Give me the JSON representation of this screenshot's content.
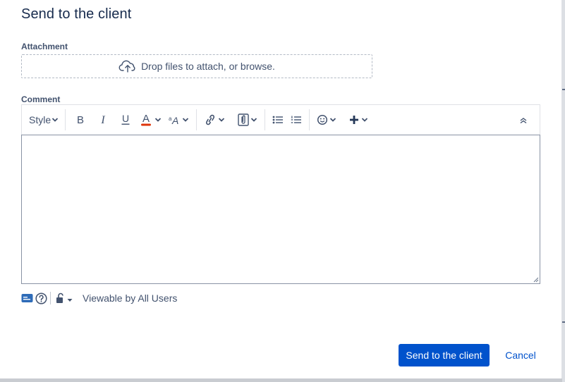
{
  "dialog": {
    "title": "Send to the client"
  },
  "attachment": {
    "label": "Attachment",
    "dropzone_text": "Drop files to attach, or browse.",
    "icon": "cloud-upload-icon"
  },
  "comment": {
    "label": "Comment",
    "value": "",
    "toolbar": {
      "style_label": "Style",
      "items": [
        "style-dropdown",
        "bold-icon",
        "italic-icon",
        "underline-icon",
        "text-color-icon",
        "text-size-icon",
        "link-icon",
        "attachment-icon",
        "bullet-list-icon",
        "numbered-list-icon",
        "emoji-icon",
        "insert-more-icon",
        "collapse-toolbar-icon"
      ],
      "text_color_accent": "#de350b"
    }
  },
  "footer": {
    "visibility_label": "Viewable by All Users"
  },
  "actions": {
    "primary_label": "Send to the client",
    "cancel_label": "Cancel"
  },
  "colors": {
    "primary": "#0052cc",
    "text": "#172b4d",
    "muted": "#42526e"
  }
}
